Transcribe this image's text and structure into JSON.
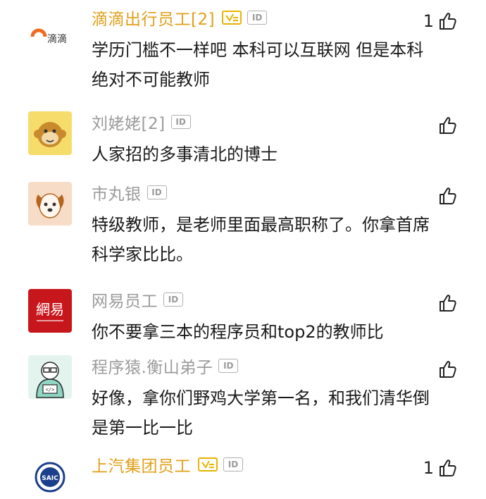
{
  "comments": [
    {
      "user": "滴滴出行员工[2]",
      "avatar_text": "滴滴",
      "verified": true,
      "id_badge": "ID",
      "text": "学历门槛不一样吧 本科可以互联网  但是本科绝对不可能教师",
      "likes": "1",
      "avatar_icon": "didi-logo-icon"
    },
    {
      "user": "刘姥姥[2]",
      "verified": false,
      "id_badge": "ID",
      "text": "人家招的多事清北的博士",
      "likes": "",
      "avatar_icon": "monkey-avatar-icon"
    },
    {
      "user": "市丸银",
      "verified": false,
      "id_badge": "ID",
      "text": "特级教师，是老师里面最高职称了。你拿首席科学家比比。",
      "likes": "",
      "avatar_icon": "dog-avatar-icon"
    },
    {
      "user": "网易员工",
      "avatar_text": "網易",
      "verified": false,
      "id_badge": "ID",
      "text": "你不要拿三本的程序员和top2的教师比",
      "likes": "",
      "avatar_icon": "netease-logo-icon"
    },
    {
      "user": "程序猿.衡山弟子",
      "verified": false,
      "id_badge": "ID",
      "text": "好像，拿你们野鸡大学第一名，和我们清华倒是第一比一比",
      "likes": "",
      "avatar_icon": "programmer-avatar-icon"
    },
    {
      "user": "上汽集团员工",
      "avatar_text": "SAIC",
      "verified": true,
      "id_badge": "ID",
      "text": "",
      "likes": "1",
      "avatar_icon": "saic-logo-icon"
    }
  ],
  "colors": {
    "verified_name": "#e0a01a",
    "plain_name": "#9b9b9b"
  }
}
